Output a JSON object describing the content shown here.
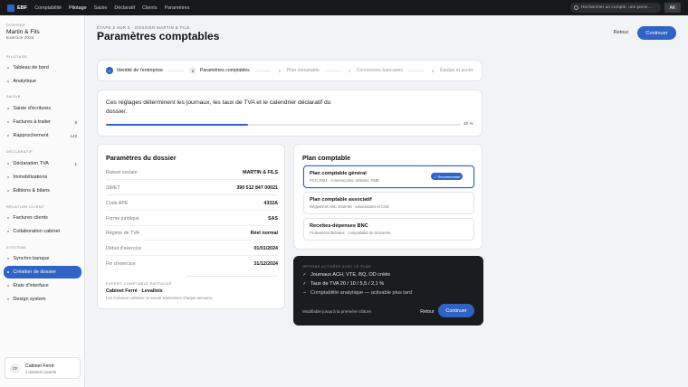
{
  "topbar": {
    "brand": "EBF",
    "nav": [
      "Comptabilité",
      "Pilotage",
      "Saisie",
      "Déclaratif",
      "Clients",
      "Paramètres"
    ],
    "search_placeholder": "Rechercher un compte, une pièce…",
    "user_initials": "AK"
  },
  "sidebar": {
    "dossier_eyebrow": "DOSSIER",
    "dossier_name": "Martin & Fils",
    "dossier_year": "Exercice 2024",
    "sections": [
      {
        "label": "PILOTAGE",
        "items": [
          {
            "label": "Tableau de bord"
          },
          {
            "label": "Analytique"
          }
        ]
      },
      {
        "label": "SAISIE",
        "items": [
          {
            "label": "Saisie d'écritures"
          },
          {
            "label": "Factures à traiter",
            "count": "8"
          },
          {
            "label": "Rapprochement",
            "count": "142"
          }
        ]
      },
      {
        "label": "DÉCLARATIF",
        "items": [
          {
            "label": "Déclaration TVA",
            "count": "1"
          },
          {
            "label": "Immobilisations"
          },
          {
            "label": "Éditions & bilans"
          }
        ]
      },
      {
        "label": "RELATION CLIENT",
        "items": [
          {
            "label": "Factures clients"
          },
          {
            "label": "Collaboration cabinet"
          }
        ]
      },
      {
        "label": "SYSTÈME",
        "items": [
          {
            "label": "Synchro banque"
          },
          {
            "label": "Création de dossier",
            "active": true
          },
          {
            "label": "États d'interface"
          },
          {
            "label": "Design system"
          }
        ]
      }
    ],
    "account": {
      "initials": "CF",
      "name": "Cabinet Ferré",
      "sub": "3 dossiers ouverts"
    }
  },
  "header": {
    "eyebrow": "ÉTAPE 2 SUR 5 · DOSSIER MARTIN & FILS",
    "title": "Paramètres comptables",
    "back_label": "Retour",
    "continue_label": "Continuer"
  },
  "stepper": [
    {
      "num": "✓",
      "label": "Identité de l'entreprise",
      "state": "done"
    },
    {
      "num": "2",
      "label": "Paramètres comptables",
      "state": "current"
    },
    {
      "num": "3",
      "label": "Plan comptable",
      "state": "todo"
    },
    {
      "num": "4",
      "label": "Connexions bancaires",
      "state": "todo"
    },
    {
      "num": "5",
      "label": "Équipe et accès",
      "state": "todo"
    }
  ],
  "intro": {
    "text": "Ces réglages déterminent les journaux, les taux de TVA et le calendrier déclaratif du dossier.",
    "progress_percent": 40,
    "progress_label": "40 %"
  },
  "params": {
    "title": "Paramètres du dossier",
    "rows": [
      {
        "key": "Raison sociale",
        "value": "MARTIN & FILS"
      },
      {
        "key": "SIRET",
        "value": "390 512 847 00021"
      },
      {
        "key": "Code APE",
        "value": "4332A"
      },
      {
        "key": "Forme juridique",
        "value": "SAS"
      },
      {
        "key": "Régime de TVA",
        "value": "Réel normal"
      },
      {
        "key": "Début d'exercice",
        "value": "01/01/2024"
      },
      {
        "key": "Fin d'exercice",
        "value": "31/12/2024"
      }
    ],
    "firm_eyebrow": "EXPERT-COMPTABLE RATTACHÉ",
    "firm_name": "Cabinet Ferré · Levallois",
    "firm_note": "Les écritures validées lui seront transmises chaque semaine."
  },
  "plan": {
    "title": "Plan comptable",
    "options": [
      {
        "title": "Plan comptable général",
        "sub": "PCG 2024 · commerçants, artisans, PME",
        "badge": "✓ Recommandé",
        "selected": true
      },
      {
        "title": "Plan comptable associatif",
        "sub": "Règlement ANC 2018-06 · associations et CSE",
        "selected": false
      },
      {
        "title": "Recettes-dépenses BNC",
        "sub": "Professions libérales · comptabilité de trésorerie",
        "selected": false
      }
    ]
  },
  "summary": {
    "eyebrow": "OPTIONS ACTIVÉES AVEC CE PLAN",
    "lines": [
      {
        "mark": "✓",
        "text": "Journaux ACH, VTE, BQ, OD créés"
      },
      {
        "mark": "✓",
        "text": "Taux de TVA 20 / 10 / 5,5 / 2,1 %"
      },
      {
        "mark": "–",
        "text": "Comptabilité analytique — activable plus tard"
      }
    ],
    "note": "Modifiable jusqu'à la première clôture.",
    "back_label": "Retour",
    "continue_label": "Continuer"
  },
  "colors": {
    "accent": "#2f63c6",
    "topbar": "#17181b",
    "summary_bg": "#1b1c20"
  }
}
